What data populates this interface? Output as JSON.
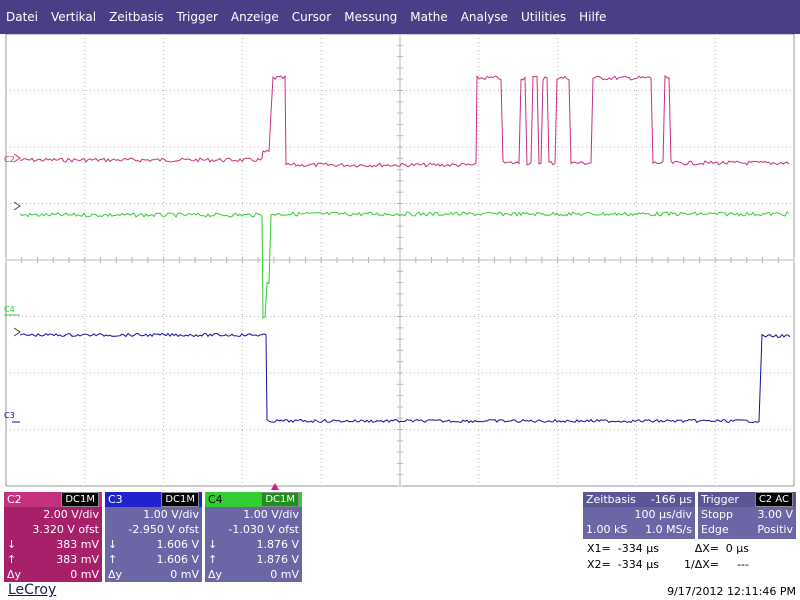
{
  "menu": [
    "Datei",
    "Vertikal",
    "Zeitbasis",
    "Trigger",
    "Anzeige",
    "Cursor",
    "Messung",
    "Mathe",
    "Analyse",
    "Utilities",
    "Hilfe"
  ],
  "colors": {
    "menubar": "#4a3f86",
    "c2": "#c4317f",
    "c3": "#1010a0",
    "c4": "#33cc33",
    "grid": "#bdbdbd",
    "panel": "#6b67a6"
  },
  "channels": {
    "c2": {
      "name": "C2",
      "coupling": "DC1M",
      "vdiv": "2.00 V/div",
      "ofst": "3.320 V ofst",
      "down_sym": "↓",
      "down": "383 mV",
      "up_sym": "↑",
      "up": "383 mV",
      "dy_label": "Δy",
      "dy": "0 mV",
      "marker": "C2"
    },
    "c3": {
      "name": "C3",
      "coupling": "DC1M",
      "vdiv": "1.00 V/div",
      "ofst": "-2.950 V ofst",
      "down_sym": "↓",
      "down": "1.606 V",
      "up_sym": "↑",
      "up": "1.606 V",
      "dy_label": "Δy",
      "dy": "0 mV",
      "marker": "C3"
    },
    "c4": {
      "name": "C4",
      "coupling": "DC1M",
      "vdiv": "1.00 V/div",
      "ofst": "-1.030 V ofst",
      "down_sym": "↓",
      "down": "1.876 V",
      "up_sym": "↑",
      "up": "1.876 V",
      "dy_label": "Δy",
      "dy": "0 mV",
      "marker": "C4"
    }
  },
  "zeitbasis": {
    "label": "Zeitbasis",
    "delay": "-166 µs",
    "tdiv": "100 µs/div",
    "samples": "1.00 kS",
    "rate": "1.0 MS/s"
  },
  "trigger": {
    "label": "Trigger",
    "badge": "C2 AC",
    "mode": "Stopp",
    "level": "3.00 V",
    "type": "Edge",
    "slope": "Positiv"
  },
  "cursors": {
    "x1_label": "X1=",
    "x1": "-334 µs",
    "dx_label": "ΔX=",
    "dx": "0 µs",
    "x2_label": "X2=",
    "x2": "-334 µs",
    "inv_label": "1/ΔX=",
    "inv": "---"
  },
  "brand": "LeCroy",
  "datetime": "9/17/2012 12:11:46 PM"
}
